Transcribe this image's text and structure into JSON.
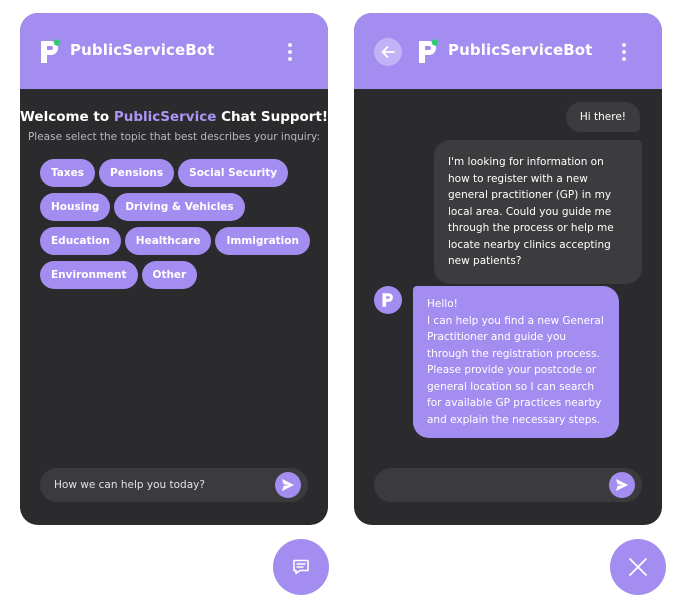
{
  "colors": {
    "accent": "#a48df0",
    "panel_bg": "#2b2b2d",
    "user_bubble": "#3c3c3f",
    "online_dot": "#2ecc71"
  },
  "icons": {
    "logo": "letter-p-logo-icon",
    "menu": "kebab-menu-icon",
    "back": "arrow-left-icon",
    "send": "paper-plane-icon",
    "chat": "chat-bubble-icon",
    "close": "close-icon"
  },
  "left_panel": {
    "header": {
      "title": "PublicServiceBot"
    },
    "welcome": {
      "prefix": "Welcome to ",
      "brand": "PublicService",
      "suffix": " Chat Support!",
      "subtitle": "Please select the topic that best describes your inquiry:"
    },
    "topics": [
      "Taxes",
      "Pensions",
      "Social Security",
      "Housing",
      "Driving & Vehicles",
      "Education",
      "Healthcare",
      "Immigration",
      "Environment",
      "Other"
    ],
    "input": {
      "placeholder": "How we can help you today?",
      "value": ""
    }
  },
  "right_panel": {
    "header": {
      "title": "PublicServiceBot"
    },
    "messages": {
      "user_greeting": "Hi there!",
      "user_question": "I'm looking for information on how to register with a new general practitioner (GP) in my local area. Could you guide me through the process or help me locate nearby clinics accepting new patients?",
      "bot_greeting": "Hello!",
      "bot_reply": "I can help you find a new General Practitioner and guide you through the registration process. Please provide your postcode or general location so I can search for available GP practices nearby and explain the necessary steps."
    },
    "input": {
      "placeholder": "",
      "value": ""
    }
  }
}
